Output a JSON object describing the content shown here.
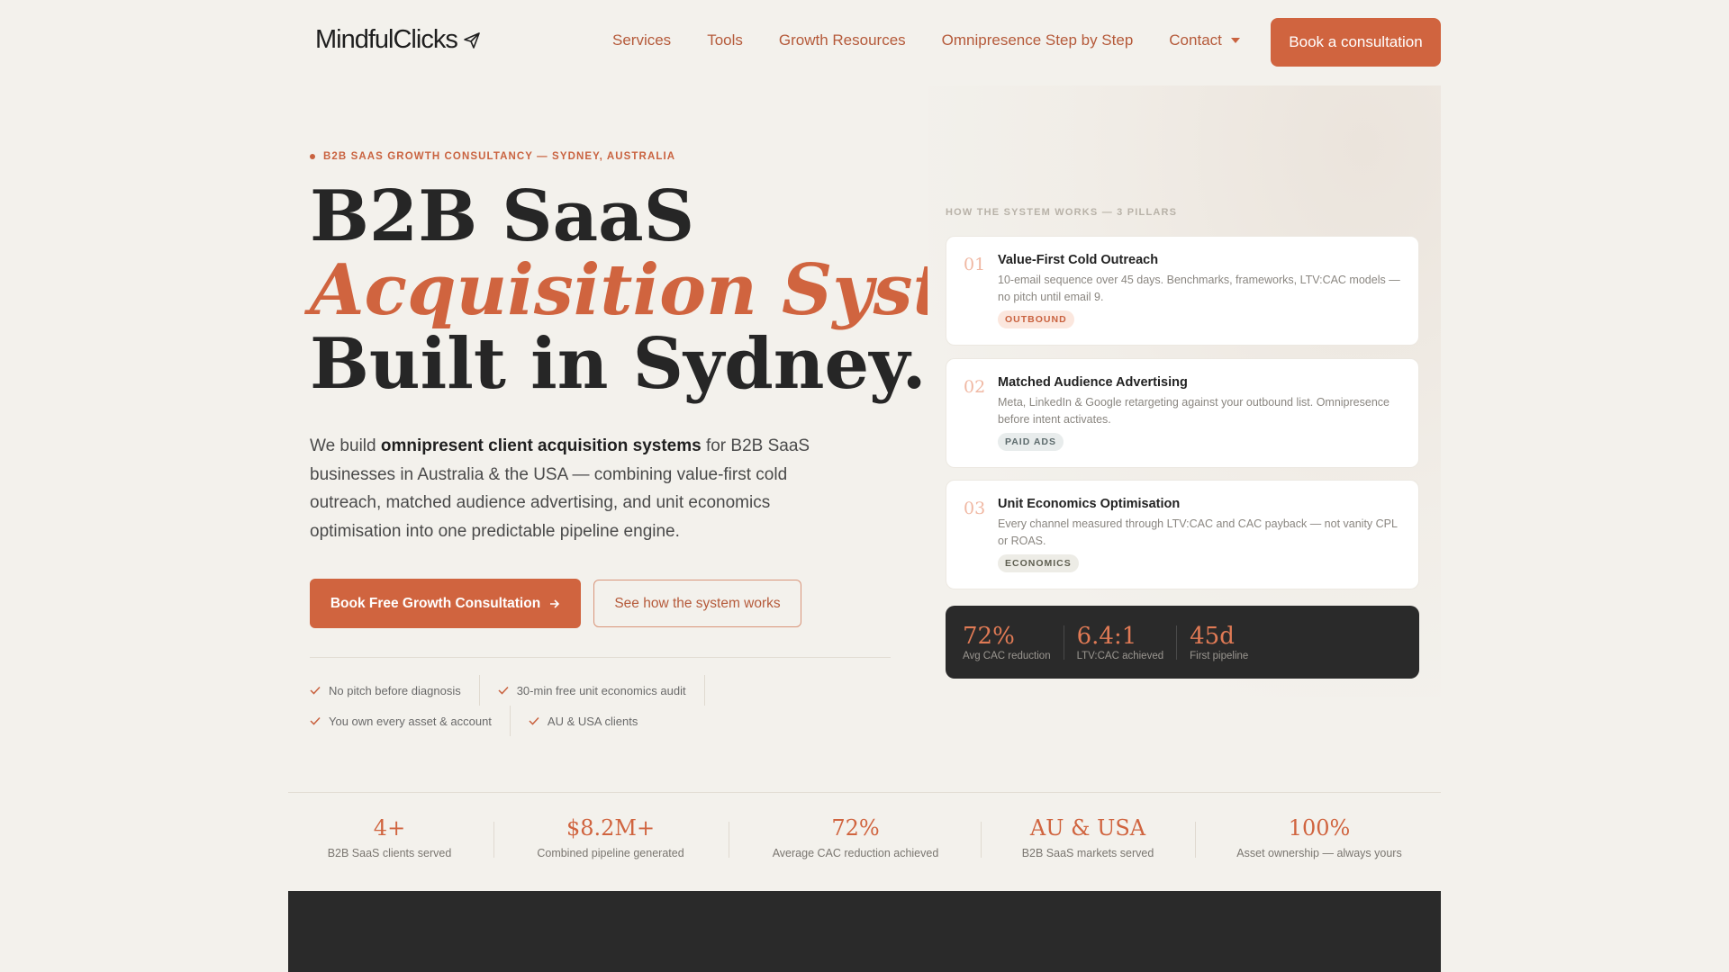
{
  "nav": {
    "logo": "MindfulClicks",
    "links": [
      "Services",
      "Tools",
      "Growth Resources",
      "Omnipresence Step by Step",
      "Contact"
    ],
    "cta": "Book a consultation"
  },
  "hero": {
    "eyebrow": "B2B SAAS GROWTH CONSULTANCY — SYDNEY, AUSTRALIA",
    "headline_1": "B2B SaaS",
    "headline_2": "Acquisition System,",
    "headline_3": "Built in Sydney.",
    "lede_1": "We build ",
    "lede_bold": "omnipresent client acquisition systems",
    "lede_2": " for B2B SaaS businesses in Australia & the USA — combining value-first cold outreach, matched audience advertising, and unit economics optimisation into one predictable pipeline engine.",
    "primary_button": "Book Free Growth Consultation",
    "secondary_button": "See how the system works",
    "checks": [
      "No pitch before diagnosis",
      "30-min free unit economics audit",
      "You own every asset & account",
      "AU & USA clients"
    ]
  },
  "pillars": {
    "label": "HOW THE SYSTEM WORKS — 3 PILLARS",
    "items": [
      {
        "num": "01",
        "title": "Value-First Cold Outreach",
        "desc": "10-email sequence over 45 days. Benchmarks, frameworks, LTV:CAC models — no pitch until email 9.",
        "tag": "OUTBOUND"
      },
      {
        "num": "02",
        "title": "Matched Audience Advertising",
        "desc": "Meta, LinkedIn & Google retargeting against your outbound list. Omnipresence before intent activates.",
        "tag": "PAID ADS"
      },
      {
        "num": "03",
        "title": "Unit Economics Optimisation",
        "desc": "Every channel measured through LTV:CAC and CAC payback — not vanity CPL or ROAS.",
        "tag": "ECONOMICS"
      }
    ],
    "stats": [
      {
        "value": "72%",
        "label": "Avg CAC reduction"
      },
      {
        "value": "6.4:1",
        "label": "LTV:CAC achieved"
      },
      {
        "value": "45d",
        "label": "First pipeline"
      }
    ]
  },
  "stats": [
    {
      "value": "4+",
      "label": "B2B SaaS clients served"
    },
    {
      "value": "$8.2M+",
      "label": "Combined pipeline generated"
    },
    {
      "value": "72%",
      "label": "Average CAC reduction achieved"
    },
    {
      "value": "AU & USA",
      "label": "B2B SaaS markets served"
    },
    {
      "value": "100%",
      "label": "Asset ownership — always yours"
    }
  ],
  "colors": {
    "accent": "#d0643f",
    "dark": "#2a2a2a",
    "background": "#f3f1ec"
  }
}
